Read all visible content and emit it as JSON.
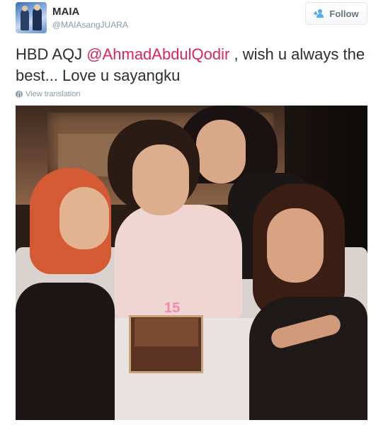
{
  "user": {
    "display_name": "MAIA",
    "screen_name": "@MAIAsangJUARA",
    "avatar_icon": "profile-avatar"
  },
  "follow_button": {
    "label": "Follow",
    "icon": "person-add-icon"
  },
  "tweet": {
    "text_before": "HBD AQJ ",
    "mention": "@AhmadAbdulQodir",
    "text_after": " , wish u always the best... Love u sayangku"
  },
  "translate": {
    "label": "View translation",
    "icon": "globe-icon"
  },
  "photo": {
    "candle_text": "15"
  },
  "colors": {
    "mention": "#e0245e",
    "follow_icon": "#55acee",
    "secondary_text": "#8899a6"
  }
}
